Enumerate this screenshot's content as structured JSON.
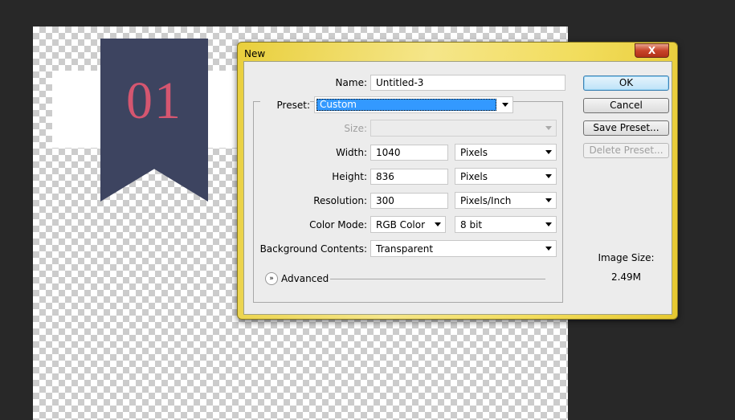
{
  "canvas": {
    "ribbon_text": "01",
    "ribbon_color": "#3d4460",
    "number_color": "#d55670"
  },
  "dialog": {
    "title": "New",
    "close_label": "X",
    "name_label": "Name:",
    "name_value": "Untitled-3",
    "preset_label": "Preset:",
    "preset_value": "Custom",
    "size_label": "Size:",
    "size_value": "",
    "width_label": "Width:",
    "width_value": "1040",
    "width_unit": "Pixels",
    "height_label": "Height:",
    "height_value": "836",
    "height_unit": "Pixels",
    "resolution_label": "Resolution:",
    "resolution_value": "300",
    "resolution_unit": "Pixels/Inch",
    "color_mode_label": "Color Mode:",
    "color_mode_value": "RGB Color",
    "bit_depth_value": "8 bit",
    "background_label": "Background Contents:",
    "background_value": "Transparent",
    "advanced_label": "Advanced",
    "buttons": {
      "ok": "OK",
      "cancel": "Cancel",
      "save_preset": "Save Preset...",
      "delete_preset": "Delete Preset..."
    },
    "image_size_label": "Image Size:",
    "image_size_value": "2.49M"
  }
}
